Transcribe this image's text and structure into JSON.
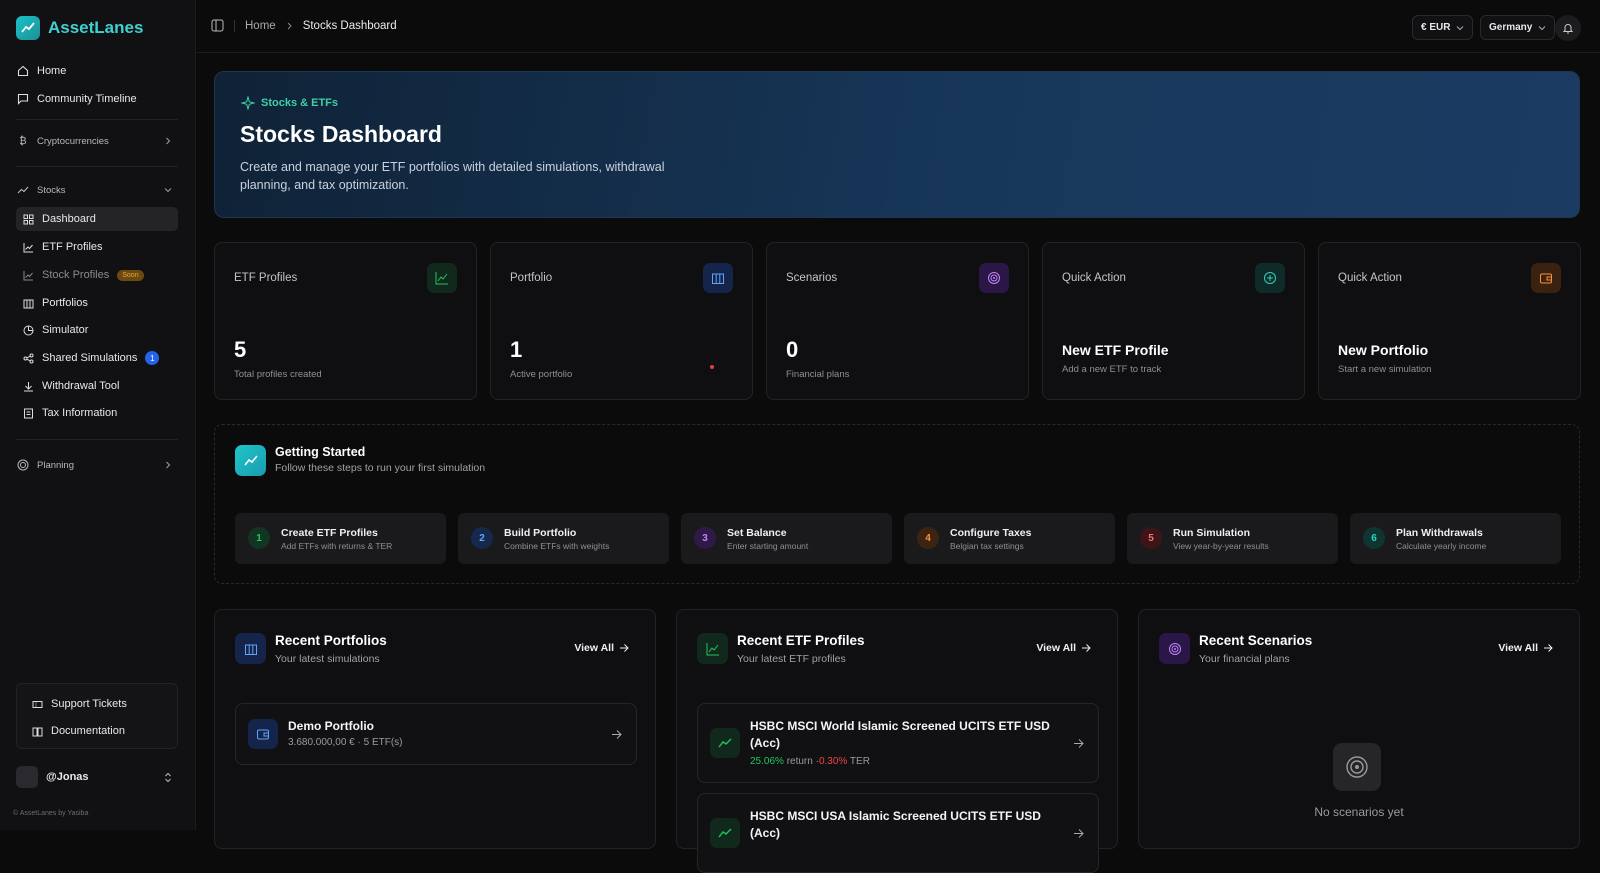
{
  "app": {
    "name": "AssetLanes"
  },
  "sidebar": {
    "top_items": [
      {
        "label": "Home",
        "icon": "home-icon"
      },
      {
        "label": "Community Timeline",
        "icon": "message-icon"
      }
    ],
    "crypto_group": "Cryptocurrencies",
    "stocks_group": "Stocks",
    "stocks_items": [
      {
        "label": "Dashboard",
        "icon": "grid-icon"
      },
      {
        "label": "ETF Profiles",
        "icon": "chart-line-icon"
      },
      {
        "label": "Stock Profiles",
        "icon": "chart-line-icon",
        "badge": "Soon"
      },
      {
        "label": "Portfolios",
        "icon": "briefcase-icon"
      },
      {
        "label": "Simulator",
        "icon": "pie-icon"
      },
      {
        "label": "Shared Simulations",
        "icon": "share-icon",
        "count": "1"
      },
      {
        "label": "Withdrawal Tool",
        "icon": "download-icon"
      },
      {
        "label": "Tax Information",
        "icon": "receipt-icon"
      }
    ],
    "planning_group": "Planning",
    "support": {
      "tickets": "Support Tickets",
      "docs": "Documentation"
    },
    "user": "@Jonas",
    "footer": "© AssetLanes by Yasiba"
  },
  "topbar": {
    "breadcrumb": {
      "home": "Home",
      "current": "Stocks Dashboard"
    },
    "currency": "€ EUR",
    "country": "Germany"
  },
  "hero": {
    "tag": "Stocks & ETFs",
    "title": "Stocks Dashboard",
    "description": "Create and manage your ETF portfolios with detailed simulations, withdrawal planning, and tax optimization."
  },
  "stats": [
    {
      "title": "ETF Profiles",
      "value": "5",
      "sub": "Total profiles created",
      "color": "#22c55e"
    },
    {
      "title": "Portfolio",
      "value": "1",
      "sub": "Active portfolio",
      "color": "#3b82f6"
    },
    {
      "title": "Scenarios",
      "value": "0",
      "sub": "Financial plans",
      "color": "#a855f7"
    },
    {
      "title": "Quick Action",
      "action": "New ETF Profile",
      "sub": "Add a new ETF to track",
      "color": "#14b8a6"
    },
    {
      "title": "Quick Action",
      "action": "New Portfolio",
      "sub": "Start a new simulation",
      "color": "#f97316"
    }
  ],
  "getting_started": {
    "title": "Getting Started",
    "subtitle": "Follow these steps to run your first simulation",
    "steps": [
      {
        "num": "1",
        "title": "Create ETF Profiles",
        "sub": "Add ETFs with returns & TER",
        "color": "#22c55e",
        "bg": "#123523"
      },
      {
        "num": "2",
        "title": "Build Portfolio",
        "sub": "Combine ETFs with weights",
        "color": "#60a5fa",
        "bg": "#16294d"
      },
      {
        "num": "3",
        "title": "Set Balance",
        "sub": "Enter starting amount",
        "color": "#c084fc",
        "bg": "#2f1a47"
      },
      {
        "num": "4",
        "title": "Configure Taxes",
        "sub": "Belgian tax settings",
        "color": "#fb923c",
        "bg": "#3d2410"
      },
      {
        "num": "5",
        "title": "Run Simulation",
        "sub": "View year-by-year results",
        "color": "#f87171",
        "bg": "#3d1518"
      },
      {
        "num": "6",
        "title": "Plan Withdrawals",
        "sub": "Calculate yearly income",
        "color": "#2dd4bf",
        "bg": "#0f3532"
      }
    ]
  },
  "panels": {
    "view_all": "View All",
    "portfolios": {
      "title": "Recent Portfolios",
      "sub": "Your latest simulations",
      "items": [
        {
          "title": "Demo Portfolio",
          "meta": "3.680.000,00 € · 5 ETF(s)"
        }
      ]
    },
    "etfs": {
      "title": "Recent ETF Profiles",
      "sub": "Your latest ETF profiles",
      "items": [
        {
          "title": "HSBC MSCI World Islamic Screened UCITS ETF USD (Acc)",
          "return": "25.06%",
          "return_label": "return",
          "sep": "·",
          "ter": "0.30%",
          "ter_label": "TER"
        },
        {
          "title": "HSBC MSCI USA Islamic Screened UCITS ETF USD (Acc)"
        }
      ]
    },
    "scenarios": {
      "title": "Recent Scenarios",
      "sub": "Your financial plans",
      "empty": "No scenarios yet"
    }
  }
}
